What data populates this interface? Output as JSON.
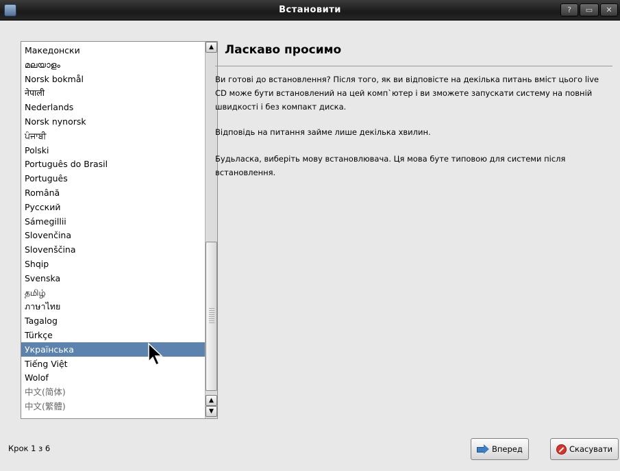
{
  "window": {
    "title": "Встановити",
    "help_label": "?",
    "maximize_label": "▭",
    "close_label": "✕"
  },
  "languages": {
    "items": [
      "Македонски",
      "മലയാളം",
      "Norsk bokmål",
      "नेपाली",
      "Nederlands",
      "Norsk nynorsk",
      "ਪੰਜਾਬੀ",
      "Polski",
      "Português do Brasil",
      "Português",
      "Română",
      "Русский",
      "Sámegillii",
      "Slovenčina",
      "Slovenščina",
      "Shqip",
      "Svenska",
      "தமிழ்",
      "ภาษาไทย",
      "Tagalog",
      "Türkçe",
      "Українська",
      "Tiếng Việt",
      "Wolof",
      "中文(简体)",
      "中文(繁體)"
    ],
    "selected": "Українська",
    "scroll_up": "▲",
    "scroll_down": "▼"
  },
  "main": {
    "heading": "Ласкаво просимо",
    "paragraph1": "Ви готові до встановлення? Після того, як ви відповісте на декілька питань вміст цього live CD може бути встановлений на цей комп`ютер і ви зможете запускати систему на повній швидкості і без компакт диска.",
    "paragraph2": "Відповідь на питання займе лише декілька хвилин.",
    "paragraph3": "Будьласка, виберіть мову встановлювача. Ця мова буте типовою для системи після встановлення."
  },
  "footer": {
    "step_label": "Крок 1 з 6",
    "next_label": "Вперед",
    "cancel_label": "Скасувати"
  },
  "colors": {
    "selection": "#5b83ad",
    "titlebar": "#262626"
  }
}
